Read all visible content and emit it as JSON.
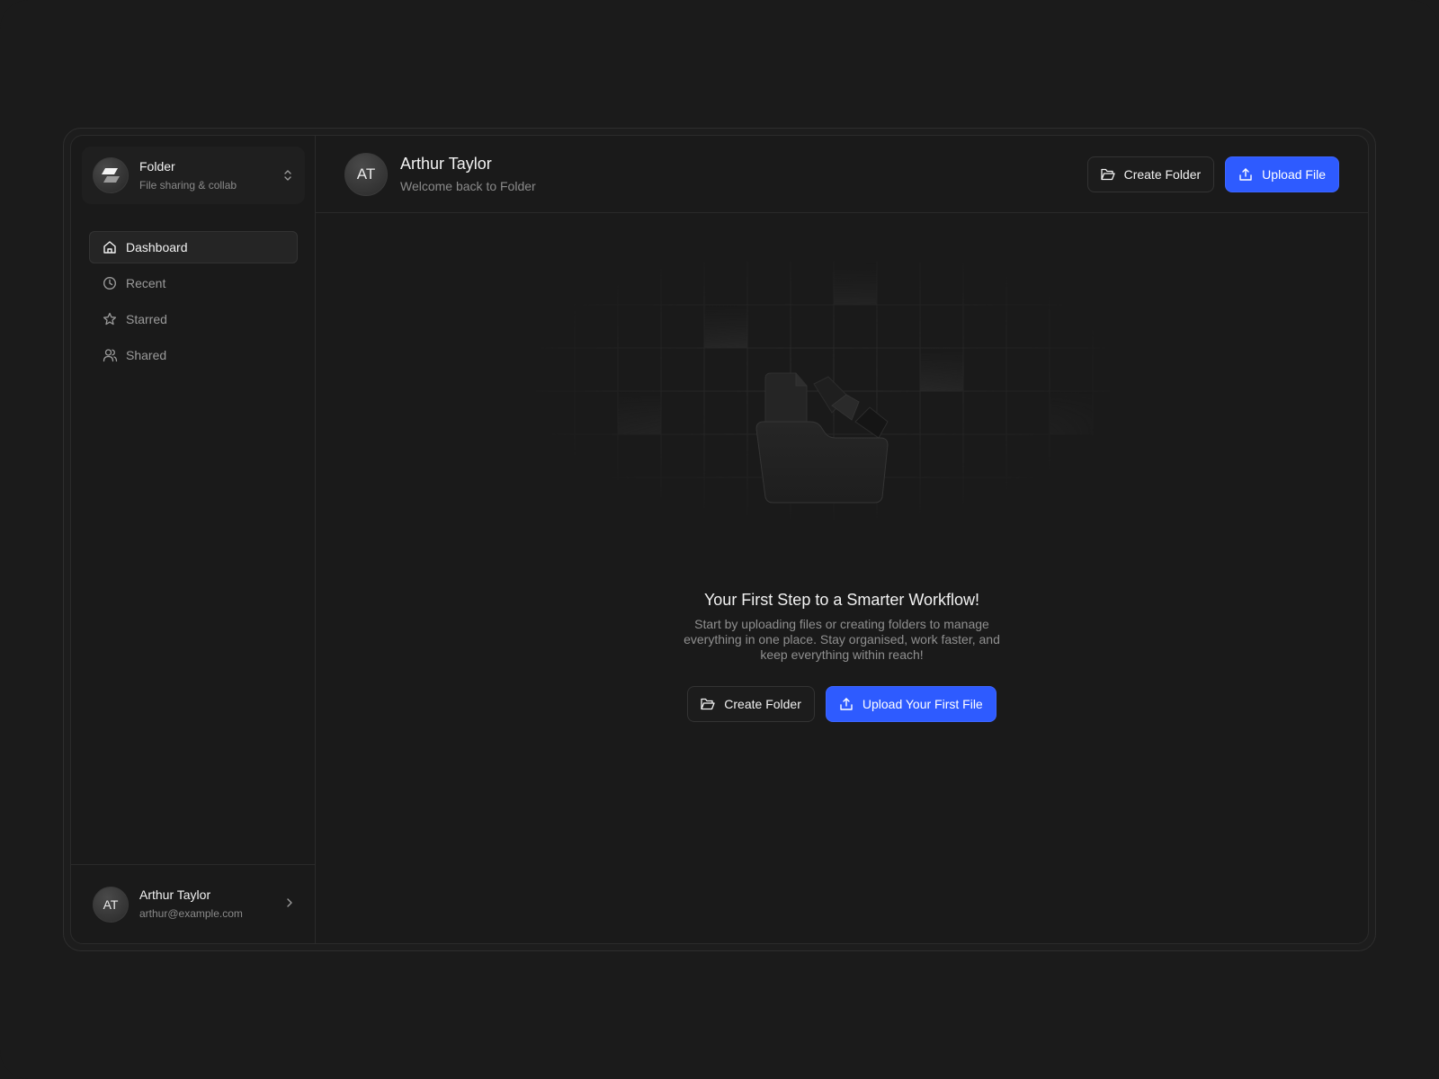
{
  "workspace": {
    "name": "Folder",
    "subtitle": "File sharing & collab"
  },
  "sidebar": {
    "items": [
      {
        "label": "Dashboard",
        "icon": "home-icon",
        "active": true
      },
      {
        "label": "Recent",
        "icon": "clock-icon",
        "active": false
      },
      {
        "label": "Starred",
        "icon": "star-icon",
        "active": false
      },
      {
        "label": "Shared",
        "icon": "users-icon",
        "active": false
      }
    ]
  },
  "user": {
    "initials": "AT",
    "name": "Arthur Taylor",
    "email": "arthur@example.com"
  },
  "header": {
    "initials": "AT",
    "name": "Arthur Taylor",
    "welcome": "Welcome back to Folder",
    "create_folder_label": "Create Folder",
    "upload_file_label": "Upload File"
  },
  "empty_state": {
    "title": "Your First Step to a Smarter Workflow!",
    "description": "Start by uploading files or creating folders to manage everything in one place. Stay organised, work faster, and keep everything within reach!",
    "create_folder_label": "Create Folder",
    "upload_label": "Upload Your First File"
  },
  "colors": {
    "background": "#1b1b1b",
    "primary": "#2e5bff",
    "text": "#f2f2f2",
    "muted": "#8a8a8a"
  }
}
